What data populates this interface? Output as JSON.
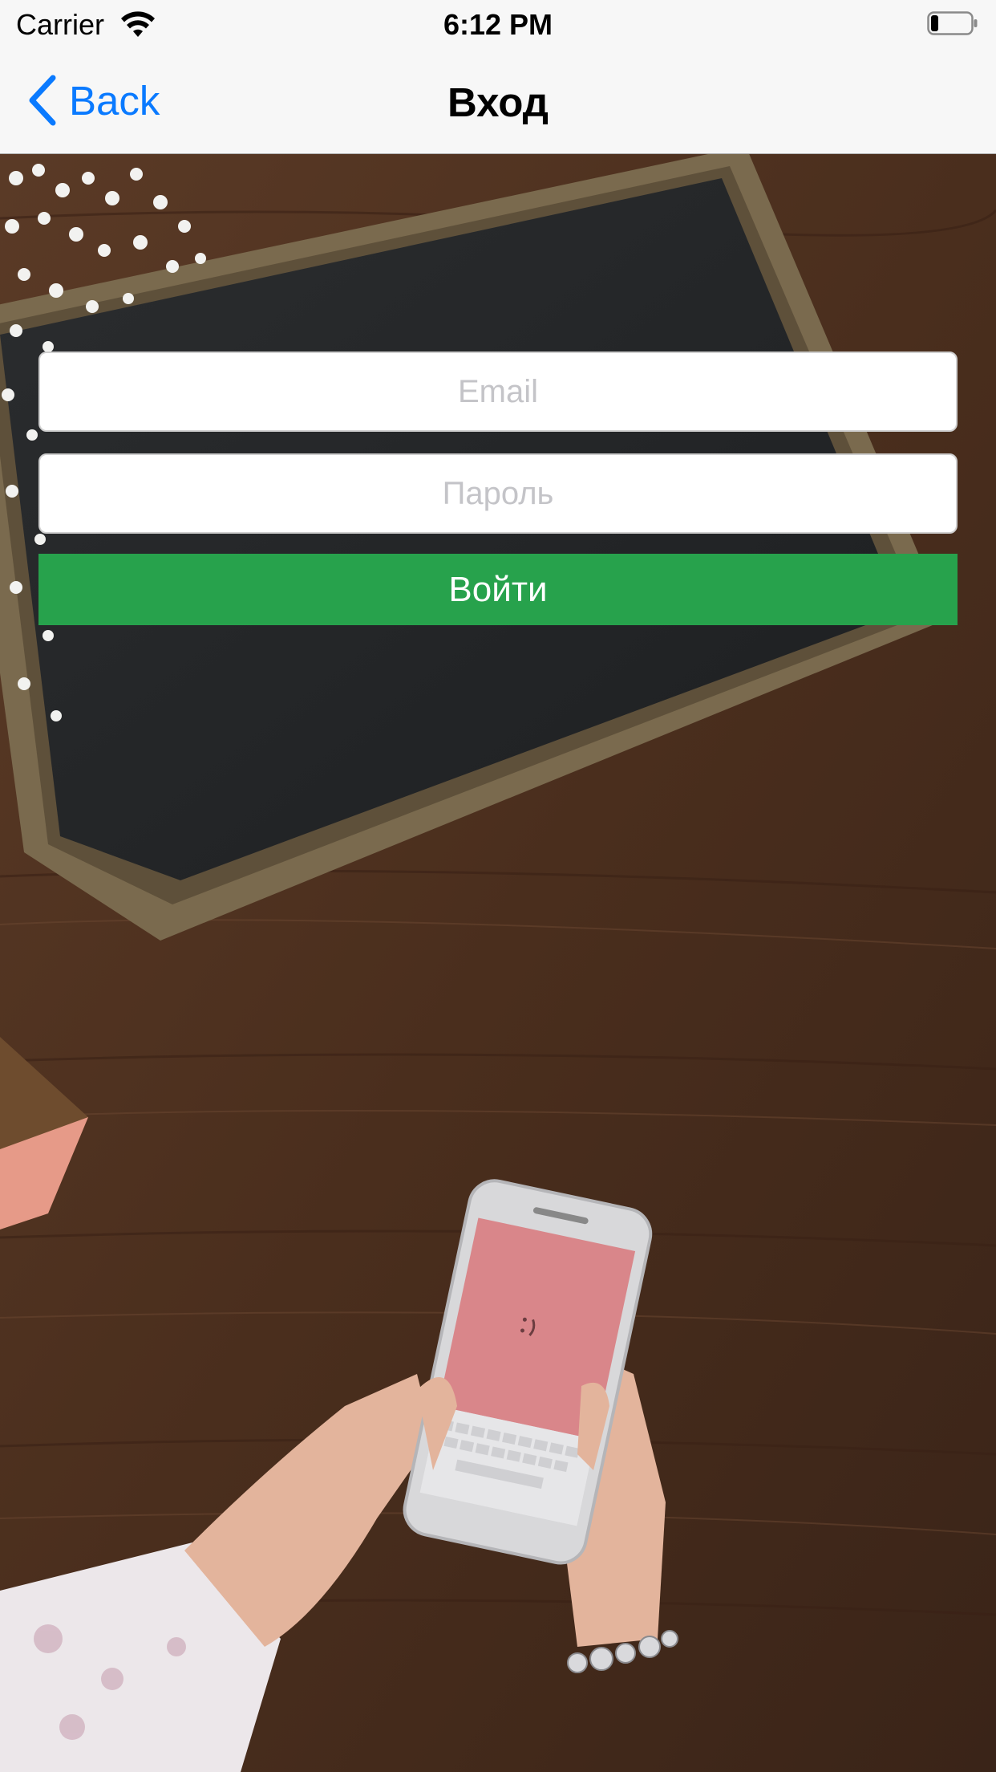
{
  "status_bar": {
    "carrier": "Carrier",
    "time": "6:12 PM",
    "wifi_icon": "wifi-icon",
    "battery_icon": "battery-low-icon"
  },
  "nav": {
    "back_label": "Back",
    "back_icon": "chevron-left-icon",
    "title": "Вход"
  },
  "form": {
    "email_placeholder": "Email",
    "email_value": "",
    "password_placeholder": "Пароль",
    "password_value": "",
    "login_label": "Войти"
  },
  "colors": {
    "accent": "#0a7aff",
    "login_button": "#27a24c",
    "bar_background": "#f7f7f7"
  }
}
